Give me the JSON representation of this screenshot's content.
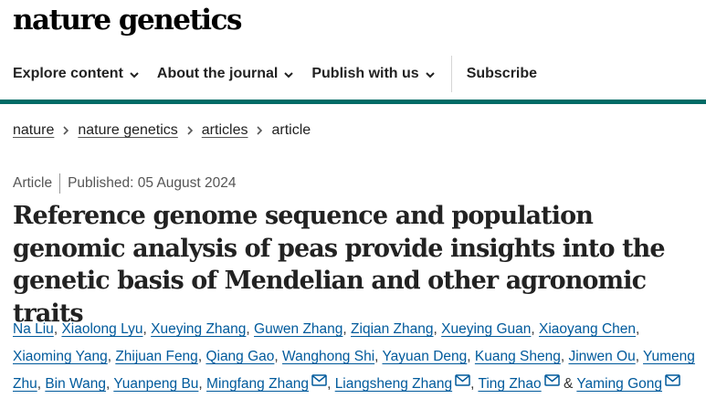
{
  "header": {
    "logo": "nature genetics"
  },
  "nav": {
    "items": [
      {
        "label": "Explore content"
      },
      {
        "label": "About the journal"
      },
      {
        "label": "Publish with us"
      }
    ],
    "subscribe": "Subscribe"
  },
  "accent_color": "#006b66",
  "link_color": "#005a9c",
  "breadcrumb": {
    "items": [
      "nature",
      "nature genetics",
      "articles"
    ],
    "current": "article"
  },
  "article": {
    "type": "Article",
    "published": "Published: 05 August 2024",
    "title": "Reference genome sequence and population genomic analysis of peas provide insights into the genetic basis of Mendelian and other agronomic traits",
    "authors": [
      "Na Liu",
      "Xiaolong Lyu",
      "Xueying Zhang",
      "Guwen Zhang",
      "Ziqian Zhang",
      "Xueying Guan",
      "Xiaoyang Chen",
      "Xiaoming Yang",
      "Zhijuan Feng",
      "Qiang Gao",
      "Wanghong Shi",
      "Yayuan Deng",
      "Kuang Sheng",
      "Jinwen Ou",
      "Yumeng Zhu",
      "Bin Wang",
      "Yuanpeng Bu",
      "Mingfang Zhang",
      "Liangsheng Zhang",
      "Ting Zhao",
      "Yaming Gong"
    ],
    "and_sep": "&"
  }
}
